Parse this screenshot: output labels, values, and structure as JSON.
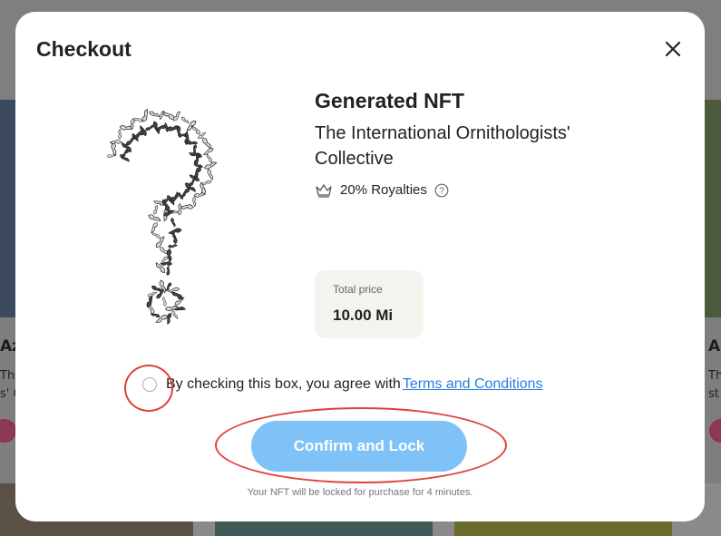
{
  "modal": {
    "title": "Checkout",
    "close_icon": "close-icon"
  },
  "nft": {
    "name": "Generated NFT",
    "collection": "The International Ornithologists' Collective",
    "royalties": "20% Royalties",
    "royalty_icon": "crown-icon",
    "help_icon": "question-circle-icon"
  },
  "price": {
    "label": "Total price",
    "value": "10.00 Mi"
  },
  "agreement": {
    "text": "By checking this box, you agree with",
    "link": "Terms and Conditions"
  },
  "confirm": {
    "label": "Confirm and Lock",
    "color": "#7ec2f7"
  },
  "note": "Your NFT will be locked for purchase for 4 minutes.",
  "background": {
    "left_card_title": "Azu",
    "left_card_desc": [
      "The",
      "s' C"
    ],
    "right_card_title": "A",
    "right_card_desc": [
      "Th",
      "st"
    ]
  },
  "colors": {
    "highlight": "#e0403c",
    "link": "#2a7de1"
  }
}
